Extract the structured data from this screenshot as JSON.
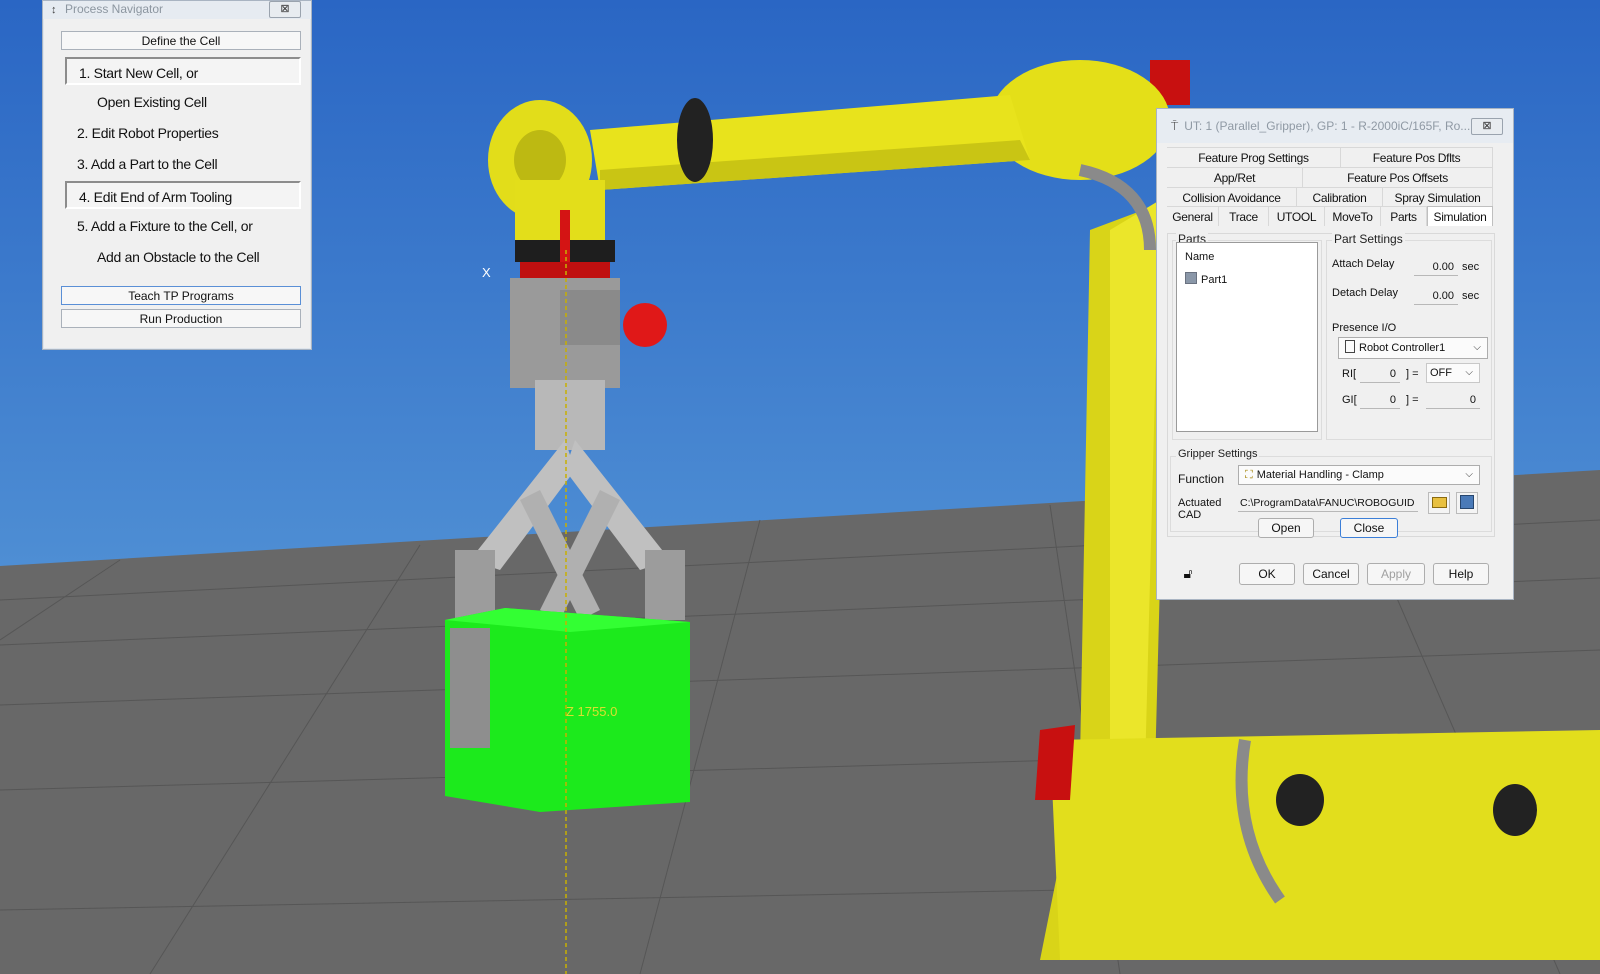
{
  "colors": {
    "sky": "#3c77c8",
    "floor": "#676767",
    "robot_yellow": "#e6e21a",
    "part_green": "#22f022",
    "robot_red": "#e0141a"
  },
  "viewport": {
    "cursor_label": "X",
    "coordinate_readout": "Z 1755.0"
  },
  "process_navigator": {
    "title": "Process Navigator",
    "close_glyph": "⊠",
    "define_cell_label": "Define the Cell",
    "items": [
      {
        "label": "1.  Start New Cell, or"
      },
      {
        "label": "Open Existing Cell"
      },
      {
        "label": "2.  Edit Robot Properties"
      },
      {
        "label": "3.  Add a Part to the Cell"
      },
      {
        "label": "4.  Edit End of Arm Tooling"
      },
      {
        "label": "5.  Add a Fixture to the Cell, or"
      },
      {
        "label": "Add an Obstacle to the Cell"
      }
    ],
    "teach_label": "Teach TP Programs",
    "run_label": "Run Production"
  },
  "ut_dialog": {
    "title": "UT: 1  (Parallel_Gripper), GP: 1 - R-2000iC/165F, Ro...",
    "close_glyph": "⊠",
    "tab_rows": [
      [
        "Feature Prog Settings",
        "Feature Pos Dflts"
      ],
      [
        "App/Ret",
        "Feature Pos Offsets"
      ],
      [
        "Collision Avoidance",
        "Calibration",
        "Spray Simulation"
      ],
      [
        "General",
        "Trace",
        "UTOOL",
        "MoveTo",
        "Parts",
        "Simulation"
      ]
    ],
    "parts": {
      "group_label": "Parts",
      "column_header": "Name",
      "items": [
        "Part1"
      ]
    },
    "part_settings": {
      "group_label": "Part Settings",
      "attach_delay_label": "Attach Delay",
      "attach_delay_value": "0.00",
      "detach_delay_label": "Detach Delay",
      "detach_delay_value": "0.00",
      "unit": "sec",
      "presence_io_label": "Presence I/O",
      "controller": "Robot Controller1",
      "ri_label": "RI[",
      "ri_index": "0",
      "ri_eq": "] =",
      "ri_state": "OFF",
      "gi_label": "GI[",
      "gi_index": "0",
      "gi_eq": "] =",
      "gi_value": "0"
    },
    "gripper": {
      "group_label": "Gripper Settings",
      "function_label": "Function",
      "function_value": "Material Handling - Clamp",
      "actuated_label_1": "Actuated",
      "actuated_label_2": "CAD",
      "cad_path": "C:\\ProgramData\\FANUC\\ROBOGUID",
      "open_label": "Open",
      "close_label": "Close"
    },
    "footer": {
      "ok_label": "OK",
      "cancel_label": "Cancel",
      "apply_label": "Apply",
      "help_label": "Help"
    }
  }
}
